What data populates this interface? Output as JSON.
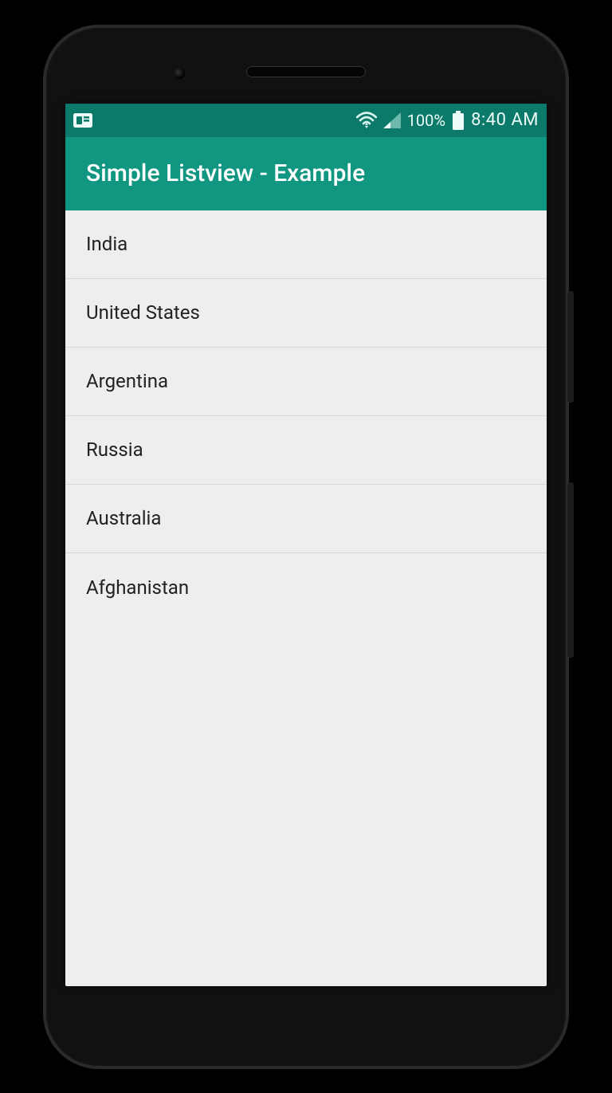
{
  "status_bar": {
    "battery_percent": "100%",
    "clock": "8:40 AM"
  },
  "app_bar": {
    "title": "Simple Listview - Example"
  },
  "list": {
    "items": [
      {
        "label": "India"
      },
      {
        "label": "United States"
      },
      {
        "label": "Argentina"
      },
      {
        "label": "Russia"
      },
      {
        "label": "Australia"
      },
      {
        "label": "Afghanistan"
      }
    ]
  },
  "colors": {
    "status_bar_bg": "#0c7a6a",
    "app_bar_bg": "#119682",
    "screen_bg": "#eeeeee"
  }
}
